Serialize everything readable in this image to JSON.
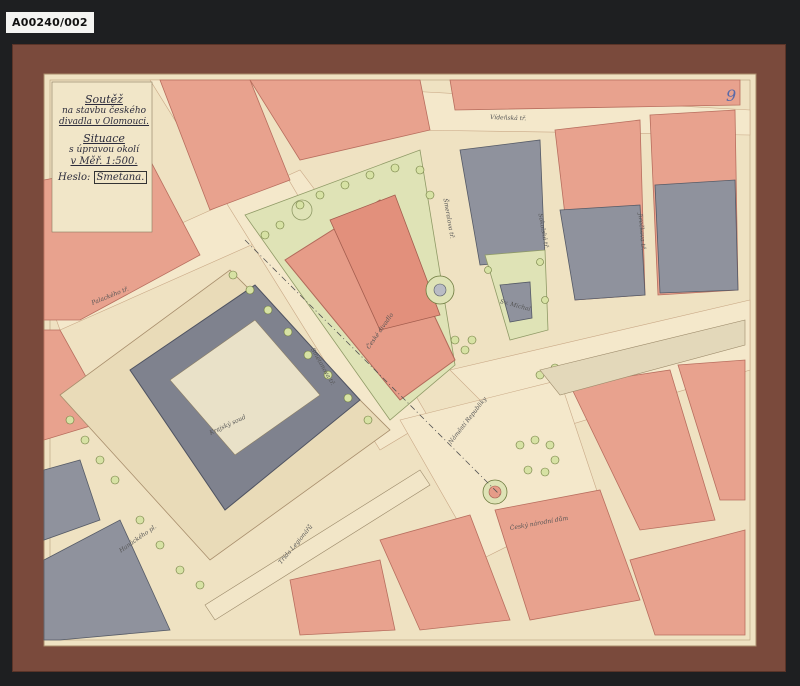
{
  "archive_id": "A00240/002",
  "sheet_number": "9",
  "cartouche": {
    "line1": "Soutěž",
    "line2": "na stavbu českého",
    "line3": "divadla v Olomouci.",
    "line4": "Situace",
    "line5": "s úpravou okolí",
    "line6": "v Měř. 1:500.",
    "motto_label": "Heslo:",
    "motto": "Smetana."
  },
  "streets": [
    "Palackého tř.",
    "Vídeňská tř.",
    "Šmeralova tř.",
    "Sokolská tř.",
    "Jirečkova tř.",
    "Smetanova tř.",
    "Náměstí Republiky",
    "Třída Legionářů",
    "Hanáckého pl."
  ],
  "buildings": [
    "Krajský soud",
    "České divadlo",
    "Sv. Michal",
    "Český národní dům"
  ],
  "colors": {
    "paper": "#efe2c2",
    "road": "#f3e6c6",
    "block_red": "#e7a08c",
    "block_grey": "#8c8f9a",
    "park": "#dfe3b6",
    "mount": "#7a4a3c"
  }
}
